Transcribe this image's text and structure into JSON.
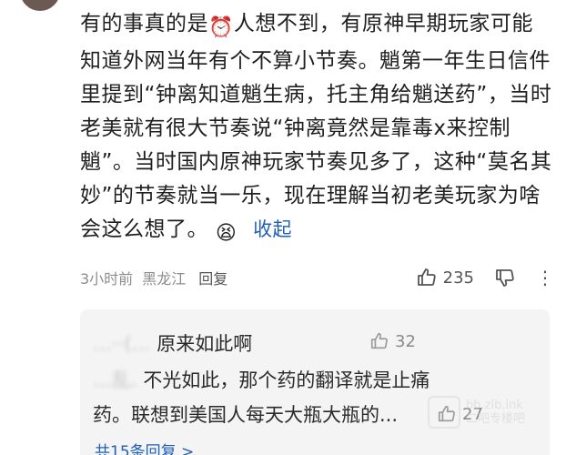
{
  "comment": {
    "text_before_icon": "有的事真的是",
    "text_after_icon": "人想不到，有原神早期玩家可能知道外网当年有个不算小节奏。魈第一年生日信件里提到“钟离知道魈生病，托主角给魈送药”，当时老美就有很大节奏说“钟离竟然是靠毒x来控制魈”。当时国内原神玩家节奏见多了，这种“莫名其妙”的节奏就当一乐，现在理解当初老美玩家为啥会这么想了。",
    "emoji_icon": "grimace-emoji",
    "clock_icon": "alarm-clock-icon",
    "collapse_label": "收起"
  },
  "meta": {
    "time": "3小时前",
    "location": "黑龙江",
    "reply_label": "回复",
    "like_count": "235"
  },
  "replies": {
    "r1_name_blurred": "…··(…",
    "r1_text": "原来如此啊",
    "r1_like_count": "32",
    "r2_prefix_blurred": "…乱.",
    "r2_text_line1": "不光如此，那个药的翻译就是止痛",
    "r2_text_line2": "药。联想到美国人每天大瓶大瓶的...",
    "r2_like_count": "27",
    "more_replies_label": "共15条回复 >"
  },
  "watermark": {
    "line1": "bb.zlb.ink",
    "line2": "二吧专楼吧"
  },
  "colors": {
    "link_blue": "#1f5fb8",
    "reply_bg": "#f4f4f4",
    "meta_gray": "#8c8c8c"
  }
}
